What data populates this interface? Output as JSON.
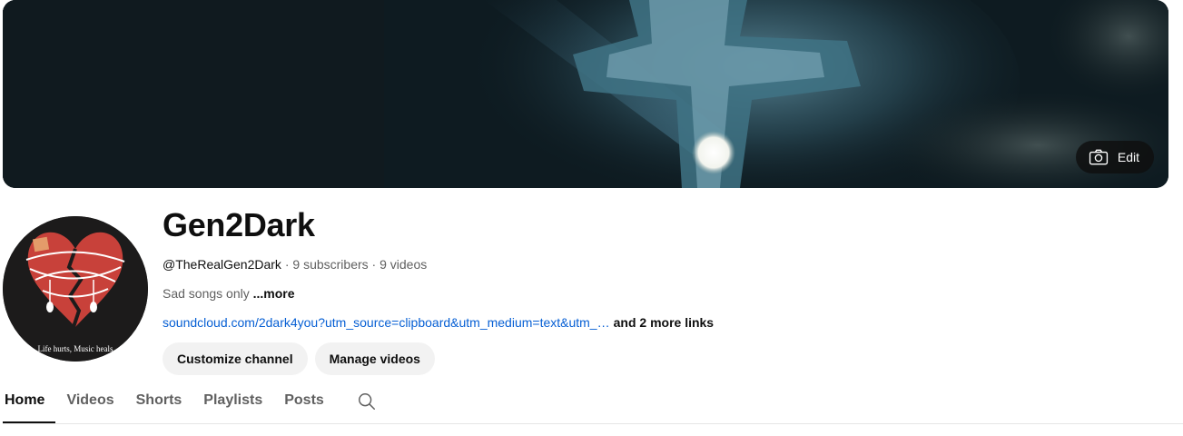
{
  "banner": {
    "edit_label": "Edit"
  },
  "avatar": {
    "caption": "Life hurts, Music heals"
  },
  "channel": {
    "name": "Gen2Dark",
    "handle": "@TheRealGen2Dark",
    "subscribers": "9 subscribers",
    "videos": "9 videos",
    "separator": " · ",
    "description": "Sad songs only ",
    "more_label": "...more",
    "link": "soundcloud.com/2dark4you?utm_source=clipboard&utm_medium=text&utm_…",
    "more_links": "and 2 more links"
  },
  "actions": {
    "customize_label": "Customize channel",
    "manage_label": "Manage videos"
  },
  "tabs": [
    {
      "label": "Home",
      "active": true
    },
    {
      "label": "Videos"
    },
    {
      "label": "Shorts"
    },
    {
      "label": "Playlists"
    },
    {
      "label": "Posts"
    }
  ],
  "icons": {
    "edit": "camera-icon",
    "tab_search": "search-icon"
  }
}
